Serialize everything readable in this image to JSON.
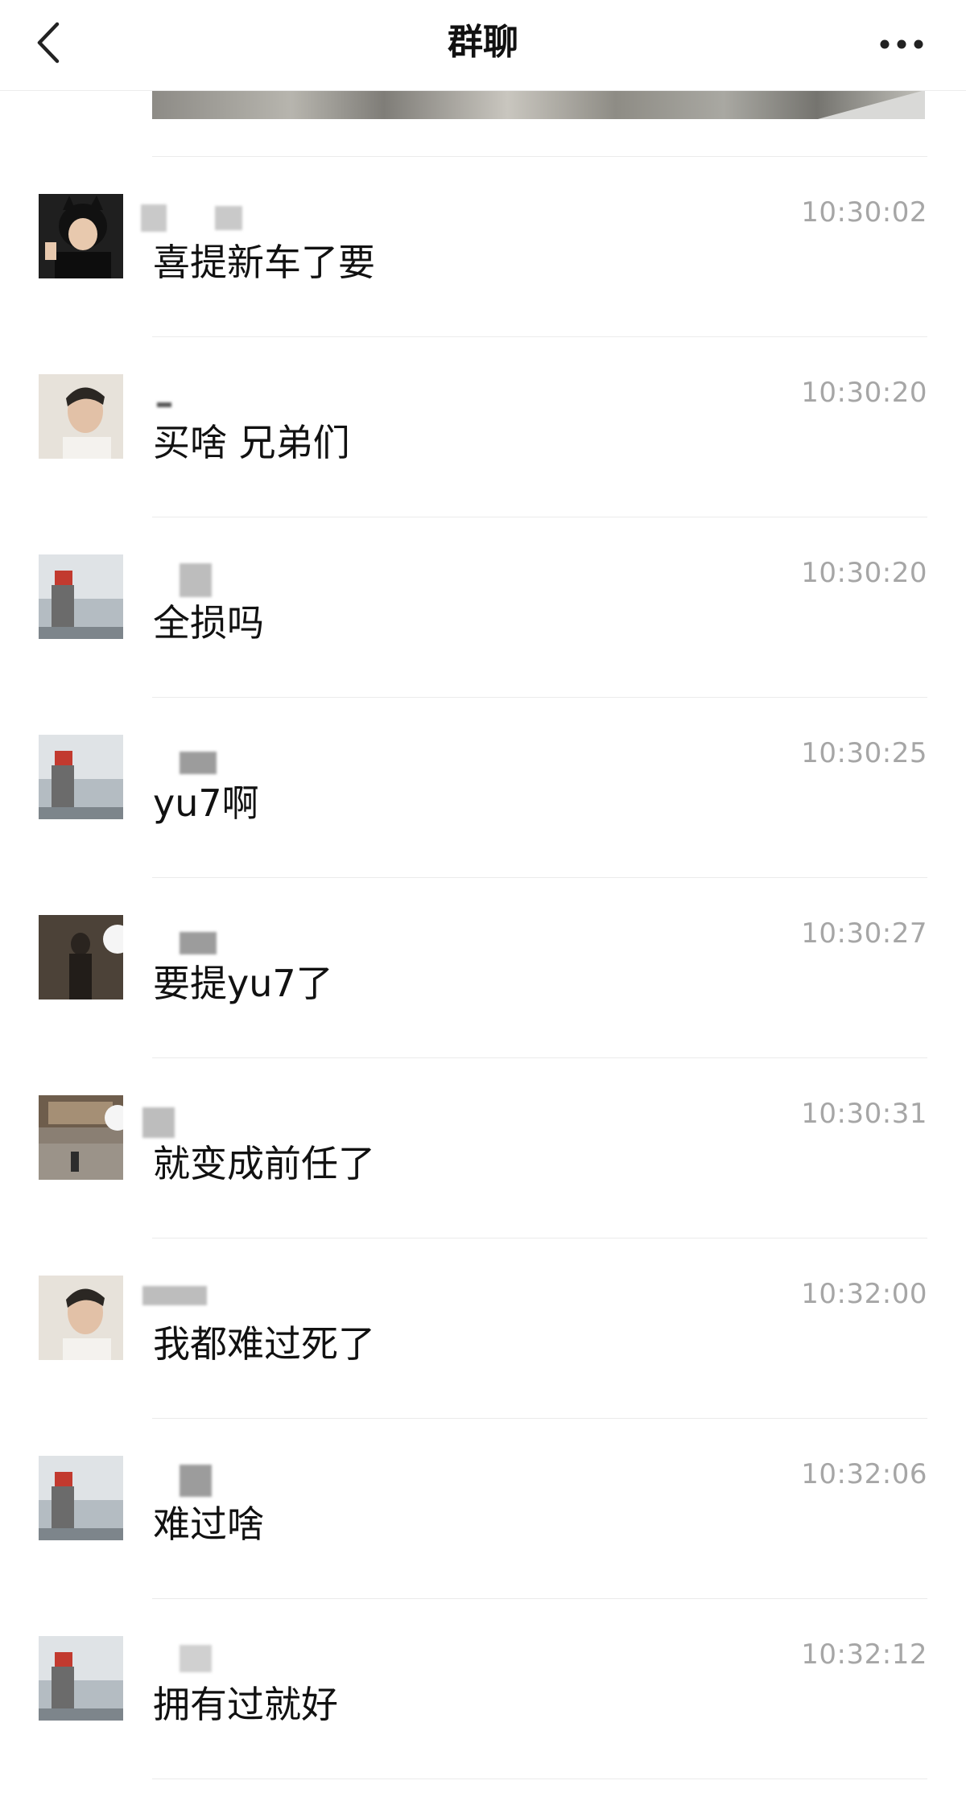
{
  "header": {
    "title": "群聊",
    "back_icon": "chevron-left-icon",
    "more_icon": "more-dots-icon"
  },
  "messages": [
    {
      "time": "10:30:02",
      "text": "喜提新车了要",
      "avatar": "child-black-hood"
    },
    {
      "time": "10:30:20",
      "text": "买啥 兄弟们",
      "avatar": "man-profile"
    },
    {
      "time": "10:30:20",
      "text": "全损吗",
      "avatar": "seaside-person"
    },
    {
      "time": "10:30:25",
      "text": "yu7啊",
      "avatar": "seaside-person"
    },
    {
      "time": "10:30:27",
      "text": "要提yu7了",
      "avatar": "dark-figure"
    },
    {
      "time": "10:30:31",
      "text": "就变成前任了",
      "avatar": "street-scene"
    },
    {
      "time": "10:32:00",
      "text": "我都难过死了",
      "avatar": "man-profile"
    },
    {
      "time": "10:32:06",
      "text": "难过啥",
      "avatar": "seaside-person"
    },
    {
      "time": "10:32:12",
      "text": "拥有过就好",
      "avatar": "seaside-person"
    }
  ]
}
